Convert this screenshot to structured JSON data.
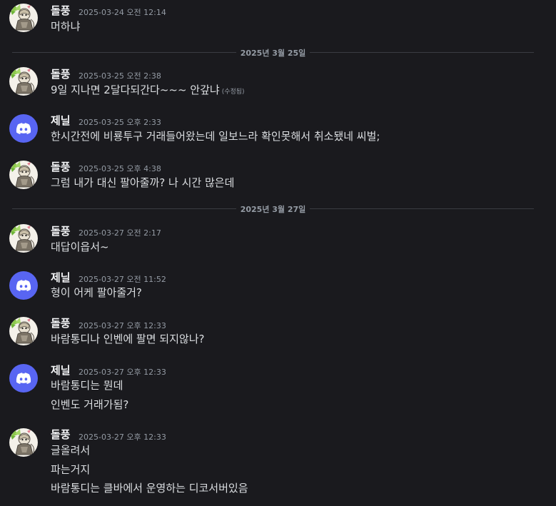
{
  "users": {
    "dolpung": {
      "name": "돌풍"
    },
    "jenil": {
      "name": "제닐"
    }
  },
  "colors": {
    "background": "#1a1a1e",
    "discord_avatar": "#5865f2",
    "name": "#f2f3f5",
    "timestamp": "#949ba4",
    "text": "#dbdee1"
  },
  "messages": [
    {
      "author": "돌풍",
      "avatar": "anime-character-avatar",
      "timestamp": "2025-03-24 오전 12:14",
      "lines": [
        "머하냐"
      ]
    },
    {
      "author": "돌풍",
      "avatar": "anime-character-avatar",
      "timestamp": "2025-03-25 오전 2:38",
      "lines": [
        "9일 지나면 2달다되간다~~~ 안갚냐"
      ],
      "edited": "(수정됨)"
    },
    {
      "author": "제닐",
      "avatar": "discord-default-avatar",
      "timestamp": "2025-03-25 오후 2:33",
      "lines": [
        "한시간전에 비룡투구 거래들어왔는데 일보느라 확인못해서 취소됐네 씨벌;"
      ]
    },
    {
      "author": "돌풍",
      "avatar": "anime-character-avatar",
      "timestamp": "2025-03-25 오후 4:38",
      "lines": [
        "그럼 내가 대신 팔아줄까? 나 시간 많은데"
      ]
    },
    {
      "author": "돌풍",
      "avatar": "anime-character-avatar",
      "timestamp": "2025-03-27 오전 2:17",
      "lines": [
        "대답이읍서~"
      ]
    },
    {
      "author": "제닐",
      "avatar": "discord-default-avatar",
      "timestamp": "2025-03-27 오전 11:52",
      "lines": [
        "형이 어케 팔아줄거?"
      ]
    },
    {
      "author": "돌풍",
      "avatar": "anime-character-avatar",
      "timestamp": "2025-03-27 오후 12:33",
      "lines": [
        "바람통디나 인벤에 팔면 되지않나?"
      ]
    },
    {
      "author": "제닐",
      "avatar": "discord-default-avatar",
      "timestamp": "2025-03-27 오후 12:33",
      "lines": [
        "바람통디는 뭔데",
        "인벤도 거래가됨?"
      ]
    },
    {
      "author": "돌풍",
      "avatar": "anime-character-avatar",
      "timestamp": "2025-03-27 오후 12:33",
      "lines": [
        "글올려서",
        "파는거지",
        "바람통디는 클바에서 운영하는 디코서버있음"
      ]
    }
  ],
  "dividers": [
    "2025년 3월 25일",
    "2025년 3월 27일"
  ]
}
